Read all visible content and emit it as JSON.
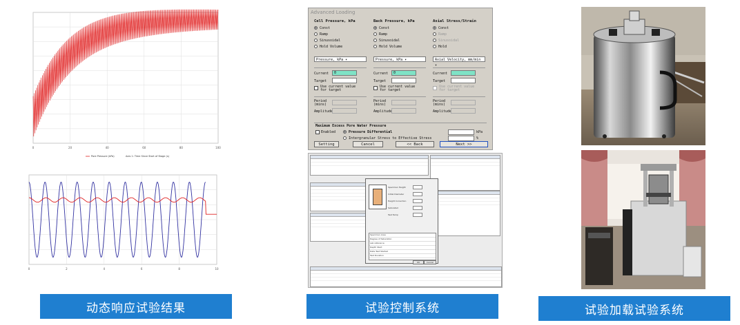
{
  "captions": {
    "left": "动态响应试验结果",
    "middle": "试验控制系统",
    "right": "试验加载试验系统"
  },
  "colors": {
    "caption_bg": "#1f7fd0",
    "pore_pressure": "#e02020",
    "stress": "#3030a0",
    "dialog_bg": "#d4d0c8",
    "field_current": "#7fe3c6"
  },
  "dialog": {
    "title": "Advanced Loading",
    "columns": [
      {
        "heading": "Cell Pressure, kPa",
        "options": [
          "Const",
          "Ramp",
          "Sinusoidal",
          "Hold Volume"
        ],
        "selected": 0,
        "unit_select": "Pressure, kPa",
        "current_label": "Current",
        "current_value": "0",
        "target_label": "Target",
        "use_current_label": "Use current value for target",
        "period_label": "Period (mins)",
        "amplitude_label": "Amplitude"
      },
      {
        "heading": "Back Pressure, kPa",
        "options": [
          "Const",
          "Ramp",
          "Sinusoidal",
          "Hold Volume"
        ],
        "selected": 0,
        "unit_select": "Pressure, kPa",
        "current_label": "Current",
        "current_value": "0",
        "target_label": "Target",
        "use_current_label": "Use current value for target",
        "period_label": "Period (mins)",
        "amplitude_label": "Amplitude"
      },
      {
        "heading": "Axial Stress/Strain",
        "options": [
          "Const",
          "Ramp",
          "Sinusoidal",
          "Hold"
        ],
        "selected": 0,
        "unit_select": "Axial Velocity, mm/min",
        "current_label": "Current",
        "current_value": "",
        "target_label": "Target",
        "use_current_label": "Use current value for target",
        "period_label": "Period (mins)",
        "amplitude_label": "Amplitude"
      }
    ],
    "excess_title": "Maximum Excess Pore Water Pressure",
    "enabled_label": "Enabled",
    "pressure_differential_label": "Pressure Differential",
    "ratio_label": "Intergranular Stress to Effective Stress",
    "kpa_unit": "kPa",
    "percent_unit": "%",
    "buttons": {
      "setting": "Setting",
      "cancel": "Cancel",
      "back": "<< Back",
      "next": "Next >>"
    }
  },
  "software": {
    "form_fields": [
      "Specimen Height",
      "Initial Diameter",
      "Height Correction",
      "Saturated",
      "Test Temp"
    ],
    "grid_rows": [
      "Specimen Area",
      "Degree of Saturation",
      "Lab reference",
      "Depth Start",
      "Date Test Started",
      "Test Duration"
    ],
    "buttons": {
      "ok": "OK",
      "cancel": "Cancel"
    }
  },
  "chart_data": [
    {
      "type": "line",
      "description_series": [
        {
          "name": "Pore Pressure (kPa)",
          "pattern": "oscillating band rising from 0.2 to ~0.95 of range then flattening"
        }
      ],
      "legend": [
        "Pore Pressure (kPa)",
        "Axis 1: Time Since Start of Stage (s)"
      ],
      "x_ticks": [
        "0",
        "20",
        "40",
        "60",
        "80",
        "100"
      ],
      "y_range": [
        0,
        1
      ],
      "grid": true
    },
    {
      "type": "line",
      "series": [
        {
          "name": "",
          "color": "#3030a0",
          "pattern": "sinusoid, 11 cycles, amplitude ~0.45 of range"
        },
        {
          "name": "",
          "color": "#e02020",
          "pattern": "slight oscillation near upper third, drops at end"
        }
      ],
      "x_ticks": [
        "0",
        "2",
        "4",
        "6",
        "8",
        "10"
      ],
      "grid": true
    }
  ]
}
